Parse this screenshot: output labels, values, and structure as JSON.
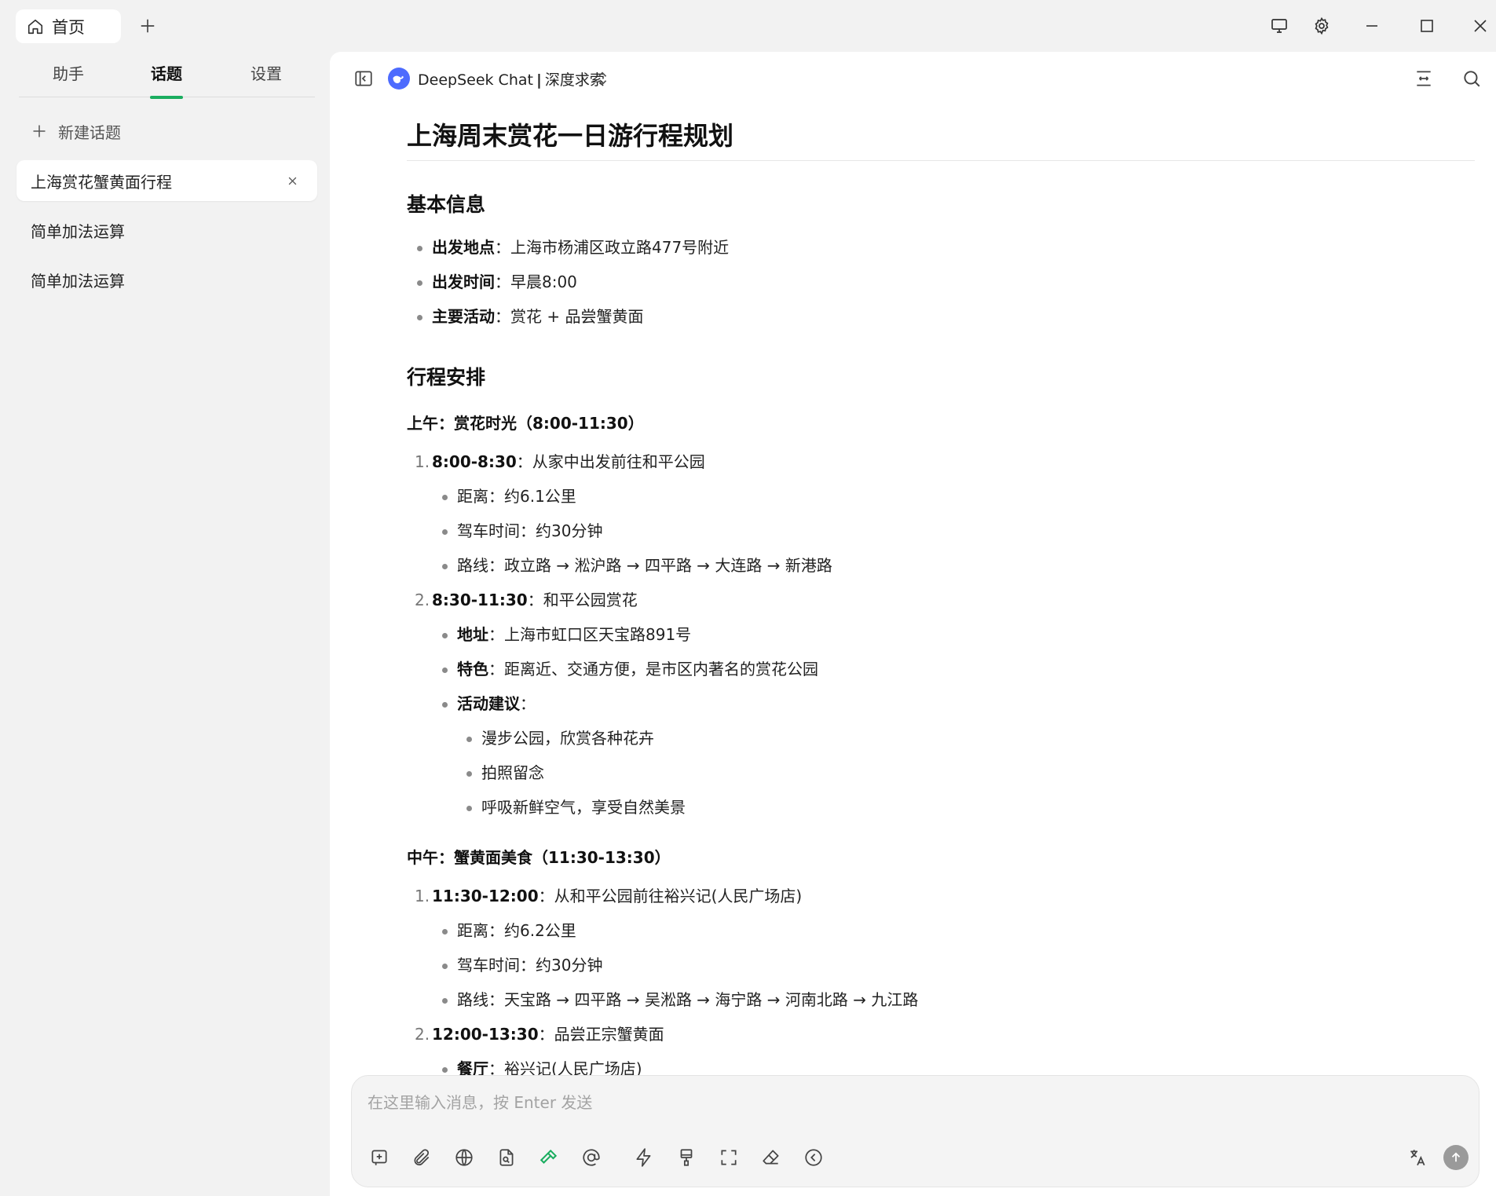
{
  "titlebar": {
    "home_tab": "首页"
  },
  "sidebar": {
    "tabs": [
      {
        "label": "助手"
      },
      {
        "label": "话题"
      },
      {
        "label": "设置"
      }
    ],
    "active_tab": "话题",
    "new_topic": "新建话题",
    "topics": [
      {
        "title": "上海赏花蟹黄面行程",
        "active": true
      },
      {
        "title": "简单加法运算",
        "active": false
      },
      {
        "title": "简单加法运算",
        "active": false
      }
    ]
  },
  "header": {
    "model": "DeepSeek Chat",
    "separator": "|",
    "mode": "深度求索"
  },
  "doc": {
    "title": "上海周末赏花一日游行程规划",
    "basic": {
      "heading": "基本信息",
      "items": [
        {
          "label": "出发地点",
          "text": "：上海市杨浦区政立路477号附近"
        },
        {
          "label": "出发时间",
          "text": "：早晨8:00"
        },
        {
          "label": "主要活动",
          "text": "：赏花 + 品尝蟹黄面"
        }
      ]
    },
    "schedule": {
      "heading": "行程安排",
      "morning": {
        "heading": "上午：赏花时光（8:00-11:30）",
        "step1": {
          "num": "1.",
          "label": "8:00-8:30",
          "text": "：从家中出发前往和平公园",
          "details": [
            "距离：约6.1公里",
            "驾车时间：约30分钟",
            "路线：政立路 → 淞沪路 → 四平路 → 大连路 → 新港路"
          ]
        },
        "step2": {
          "num": "2.",
          "label": "8:30-11:30",
          "text": "：和平公园赏花",
          "address_label": "地址",
          "address_text": "：上海市虹口区天宝路891号",
          "feature_label": "特色",
          "feature_text": "：距离近、交通方便，是市区内著名的赏花公园",
          "activity_label": "活动建议",
          "activity_text": "：",
          "activities": [
            "漫步公园，欣赏各种花卉",
            "拍照留念",
            "呼吸新鲜空气，享受自然美景"
          ]
        }
      },
      "noon": {
        "heading": "中午：蟹黄面美食（11:30-13:30）",
        "step1": {
          "num": "1.",
          "label": "11:30-12:00",
          "text": "：从和平公园前往裕兴记(人民广场店)",
          "details": [
            "距离：约6.2公里",
            "驾车时间：约30分钟",
            "路线：天宝路 → 四平路 → 吴淞路 → 海宁路 → 河南北路 → 九江路"
          ]
        },
        "step2": {
          "num": "2.",
          "label": "12:00-13:30",
          "text": "：品尝正宗蟹黄面",
          "restaurant_label": "餐厅",
          "restaurant_text": "：裕兴记(人民广场店)"
        }
      }
    }
  },
  "composer": {
    "placeholder": "在这里输入消息，按 Enter 发送",
    "value": ""
  },
  "colors": {
    "accent": "#1aad5f",
    "model_logo": "#4d6bfe",
    "tool_active": "#1aad5f"
  }
}
